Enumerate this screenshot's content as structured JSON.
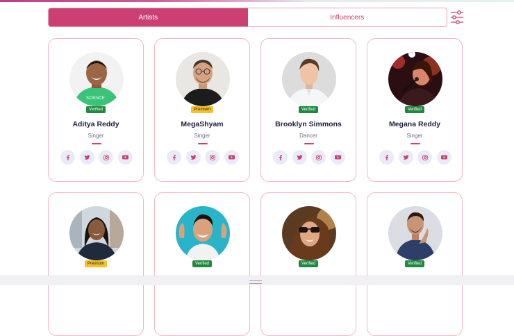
{
  "tabs": [
    {
      "label": "Artists",
      "active": true
    },
    {
      "label": "Influencers",
      "active": false
    }
  ],
  "filter_icon": "sliders-icon",
  "accent_color": "#cc3f72",
  "cards": [
    {
      "name": "Aditya Reddy",
      "role": "Singer",
      "badge": "Verified",
      "badge_type": "verified"
    },
    {
      "name": "MegaShyam",
      "role": "Singer",
      "badge": "Premium",
      "badge_type": "premium"
    },
    {
      "name": "Brooklyn Simmons",
      "role": "Dancer",
      "badge": "Verified",
      "badge_type": "verified"
    },
    {
      "name": "Megana Reddy",
      "role": "Singer",
      "badge": "Verified",
      "badge_type": "verified"
    },
    {
      "name": "",
      "role": "",
      "badge": "Premium",
      "badge_type": "premium"
    },
    {
      "name": "",
      "role": "",
      "badge": "Verified",
      "badge_type": "verified"
    },
    {
      "name": "",
      "role": "",
      "badge": "Verified",
      "badge_type": "verified"
    },
    {
      "name": "",
      "role": "",
      "badge": "Verified",
      "badge_type": "verified"
    }
  ],
  "social_icons": [
    "facebook-icon",
    "twitter-icon",
    "instagram-icon",
    "youtube-icon"
  ]
}
